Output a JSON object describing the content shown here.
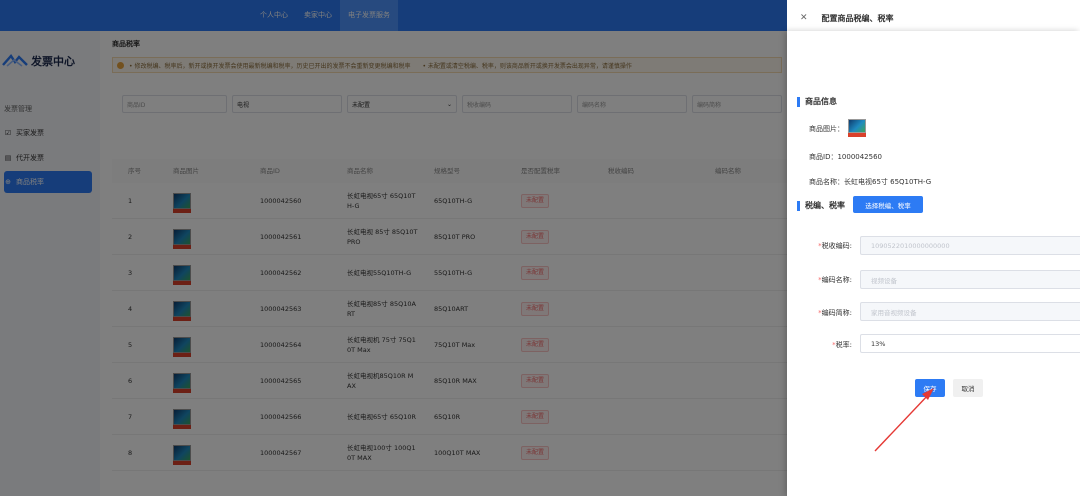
{
  "topnav": [
    "个人中心",
    "卖家中心",
    "电子发票服务"
  ],
  "sidebar": {
    "logo_title": "发票中心",
    "group": "发票管理",
    "items": [
      {
        "label": "买家发票",
        "icon": "invoice-icon"
      },
      {
        "label": "代开发票",
        "icon": "document-icon"
      },
      {
        "label": "商品税率",
        "icon": "tax-icon"
      }
    ]
  },
  "main": {
    "title": "商品税率",
    "notice": "• 修改税编、税率后，新开或换开发票会使用最新税编和税率，历史已开出的发票不会重新变更税编和税率　　• 未配置或清空税编、税率，则该商品新开或换开发票会出现异常，请谨慎操作",
    "filters": [
      {
        "placeholder": "商品ID"
      },
      {
        "value": "电视"
      },
      {
        "value": "未配置",
        "has_chevron": true
      },
      {
        "placeholder": "税收编码"
      },
      {
        "placeholder": "编码名称"
      },
      {
        "placeholder": "编码简称"
      }
    ],
    "columns": [
      "序号",
      "商品图片",
      "商品ID",
      "商品名称",
      "规格型号",
      "是否配置税率",
      "税收编码",
      "编码名称"
    ],
    "rows": [
      {
        "idx": "1",
        "id": "1000042560",
        "name": "长虹电视65寸 65Q10T H-G",
        "spec": "65Q10TH-G",
        "status": "未配置"
      },
      {
        "idx": "2",
        "id": "1000042561",
        "name": "长虹电视 85寸 85Q10T PRO",
        "spec": "85Q10T PRO",
        "status": "未配置"
      },
      {
        "idx": "3",
        "id": "1000042562",
        "name": "长虹电视55Q10TH-G",
        "spec": "55Q10TH-G",
        "status": "未配置"
      },
      {
        "idx": "4",
        "id": "1000042563",
        "name": "长虹电视85寸 85Q10A RT",
        "spec": "85Q10ART",
        "status": "未配置"
      },
      {
        "idx": "5",
        "id": "1000042564",
        "name": "长虹电视机 75寸 75Q1 0T Max",
        "spec": "75Q10T Max",
        "status": "未配置"
      },
      {
        "idx": "6",
        "id": "1000042565",
        "name": "长虹电视机85Q10R M AX",
        "spec": "85Q10R MAX",
        "status": "未配置"
      },
      {
        "idx": "7",
        "id": "1000042566",
        "name": "长虹电视65寸 65Q10R",
        "spec": "65Q10R",
        "status": "未配置"
      },
      {
        "idx": "8",
        "id": "1000042567",
        "name": "长虹电视100寸 100Q1 0T MAX",
        "spec": "100Q10T MAX",
        "status": "未配置"
      }
    ]
  },
  "panel": {
    "title": "配置商品税编、税率",
    "section_info": "商品信息",
    "image_label": "商品图片：",
    "id_line": "商品ID：1000042560",
    "name_line": "商品名称：长虹电视65寸 65Q10TH-G",
    "section_tax": "税编、税率",
    "choose_button": "选择税编、税率",
    "fields": [
      {
        "label": "税收编码:",
        "required": true,
        "value": "1090522010000000000",
        "filled": false
      },
      {
        "label": "编码名称:",
        "required": true,
        "value": "视频设备",
        "filled": false
      },
      {
        "label": "编码简称:",
        "required": true,
        "value": "家用音视频设备",
        "filled": false
      },
      {
        "label": "税率:",
        "required": true,
        "value": "13%",
        "filled": true
      }
    ],
    "save": "保存",
    "cancel": "取消"
  }
}
